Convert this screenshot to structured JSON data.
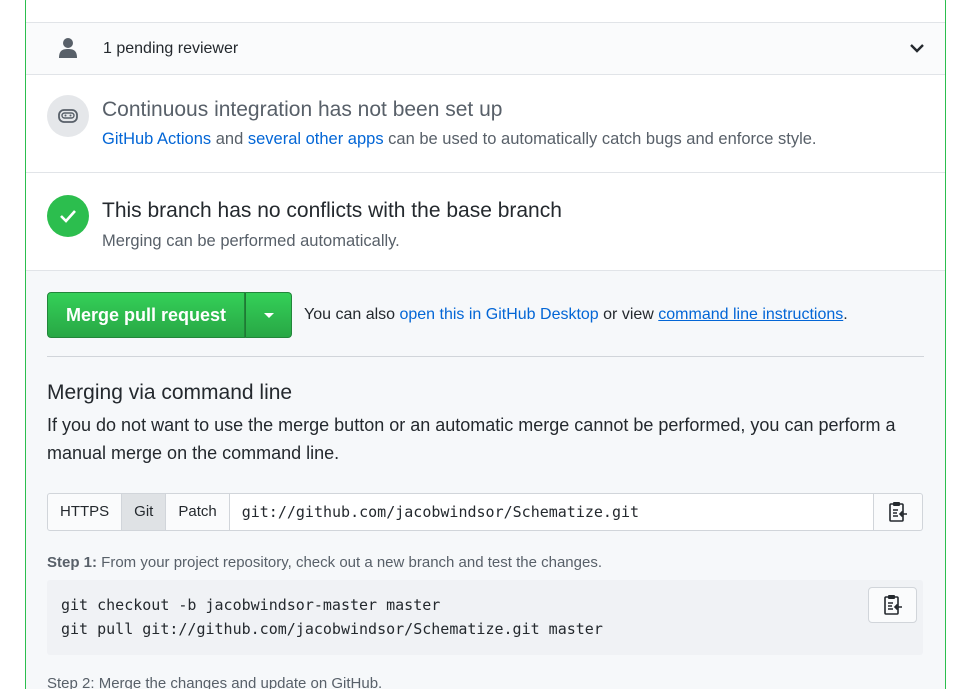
{
  "reviewers": {
    "label": "1 pending reviewer"
  },
  "ci": {
    "title": "Continuous integration has not been set up",
    "link1": "GitHub Actions",
    "and": " and ",
    "link2": "several other apps",
    "rest": " can be used to automatically catch bugs and enforce style."
  },
  "conflicts": {
    "title": "This branch has no conflicts with the base branch",
    "desc": "Merging can be performed automatically."
  },
  "merge": {
    "button_label": "Merge pull request",
    "also_prefix": "You can also ",
    "desktop_link": "open this in GitHub Desktop",
    "or_view": " or view ",
    "cli_link": "command line instructions",
    "suffix": "."
  },
  "cli": {
    "title": "Merging via command line",
    "desc": "If you do not want to use the merge button or an automatic merge cannot be performed, you can perform a manual merge on the command line.",
    "tabs": {
      "https": "HTTPS",
      "git": "Git",
      "patch": "Patch"
    },
    "url": "git://github.com/jacobwindsor/Schematize.git",
    "step1_label": "Step 1:",
    "step1_text": " From your project repository, check out a new branch and test the changes.",
    "code_line1": "git checkout -b jacobwindsor-master master",
    "code_line2": "git pull git://github.com/jacobwindsor/Schematize.git master",
    "step2_text": "Step 2: Merge the changes and update on GitHub."
  },
  "colors": {
    "success": "#2cbe4e",
    "link": "#0366d6",
    "merge_button": "#28a745"
  }
}
